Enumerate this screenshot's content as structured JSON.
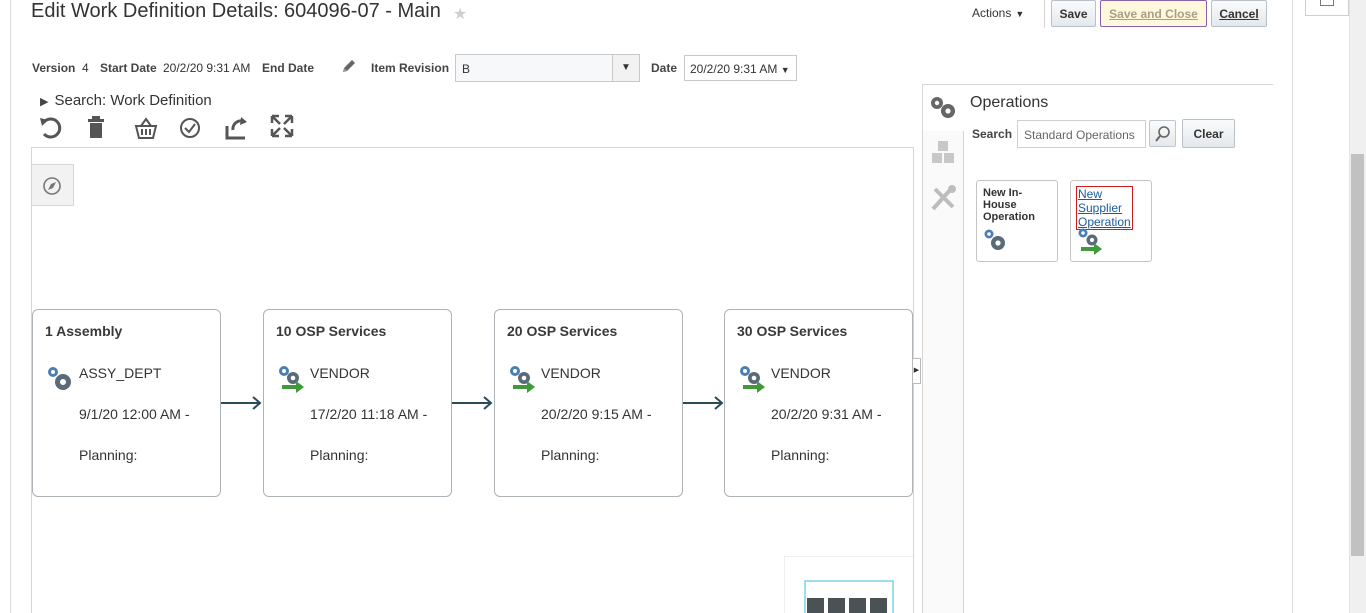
{
  "header": {
    "title": "Edit Work Definition Details: 604096-07 - Main",
    "actions_label": "Actions",
    "save_label": "Save",
    "save_close_label": "Save and Close",
    "cancel_label": "Cancel"
  },
  "details": {
    "version_label": "Version",
    "version_value": "4",
    "start_date_label": "Start Date",
    "start_date_value": "20/2/20 9:31 AM",
    "end_date_label": "End Date",
    "end_date_value": "",
    "item_revision_label": "Item Revision",
    "item_revision_value": "B",
    "date_label": "Date",
    "date_value": "20/2/20 9:31 AM"
  },
  "search_section": {
    "label": "Search: Work Definition"
  },
  "toolbar": {
    "icons": [
      "undo-icon",
      "delete-icon",
      "basket-icon",
      "check-icon",
      "refresh-icon",
      "fullscreen-icon"
    ]
  },
  "operations": [
    {
      "title": "1 Assembly",
      "dept": "ASSY_DEPT",
      "date": "9/1/20 12:00 AM -",
      "planning": "Planning:",
      "icon": "in-house-operation-icon"
    },
    {
      "title": "10 OSP Services",
      "dept": "VENDOR",
      "date": "17/2/20 11:18 AM -",
      "planning": "Planning:",
      "icon": "supplier-operation-icon"
    },
    {
      "title": "20 OSP Services",
      "dept": "VENDOR",
      "date": "20/2/20 9:15 AM -",
      "planning": "Planning:",
      "icon": "supplier-operation-icon"
    },
    {
      "title": "30 OSP Services",
      "dept": "VENDOR",
      "date": "20/2/20 9:31 AM -",
      "planning": "Planning:",
      "icon": "supplier-operation-icon"
    }
  ],
  "panel": {
    "title": "Operations",
    "search_label": "Search",
    "search_placeholder": "Standard Operations",
    "clear_label": "Clear",
    "cards": [
      {
        "label": "New In-House Operation"
      },
      {
        "label": "New Supplier Operation"
      }
    ]
  },
  "colors": {
    "link": "#1a5c9a",
    "focus_border": "#cc1e1e",
    "gear": "#5a6a78",
    "arrow_green": "#3e9a3a",
    "connector": "#2b4a5a"
  }
}
